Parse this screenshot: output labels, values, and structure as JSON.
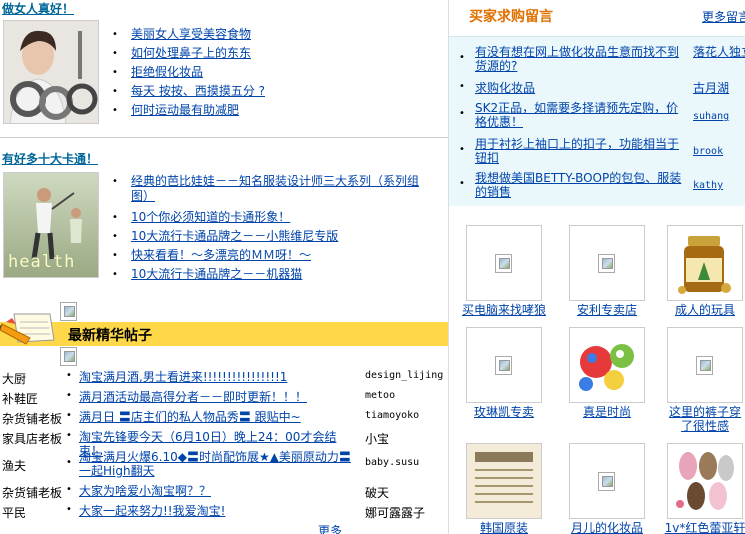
{
  "section1": {
    "title": "做女人真好！",
    "items": [
      "美丽女人享受美容食物",
      "如何处理鼻子上的东东",
      "拒绝假化妆品",
      "每天  按按、西摸摸五分  ?",
      "何时运动最有助减肥"
    ]
  },
  "section2": {
    "title": "有好多十大卡通！",
    "items": [
      "经典的芭比娃娃－－知名服装设计师三大系列（系列组图）",
      "10个你必须知道的卡通形象！",
      "10大流行卡通品牌之－－小熊维尼专版",
      "快来看看！～多漂亮的ＭＭ呀！～",
      "10大流行卡通品牌之－－机器猫"
    ],
    "thumb_caption": "health"
  },
  "featured": {
    "title": "最新精华帖子",
    "posts": [
      {
        "category": "大厨",
        "title": "淘宝满月酒,男士看进来!!!!!!!!!!!!!!!!1",
        "author": "design_lijing"
      },
      {
        "category": "补鞋匠",
        "title": "满月酒活动最高得分者－－即时更新！！！",
        "author": "metoo"
      },
      {
        "category": "杂货铺老板",
        "title": "满月日 〓店主们的私人物品秀〓 跟贴中~",
        "author": "tiamoyoko"
      },
      {
        "category": "家具店老板",
        "title": "淘宝先锋要今天（6月10日）晚上24：00才会结束！",
        "author": "小宝"
      },
      {
        "category": "渔夫",
        "title": "淘宝满月火爆6.10◆〓时尚配饰展★▲美丽原动力〓一起High翻天",
        "author": "baby.susu"
      },
      {
        "category": "杂货铺老板",
        "title": "大家为啥爱小淘宝啊？？",
        "author": "破天"
      },
      {
        "category": "平民",
        "title": "大家一起来努力!!我爱淘宝!",
        "author": "娜可露露子"
      }
    ],
    "more": "更多"
  },
  "requests": {
    "title": "买家求购留言",
    "more": "更多留言",
    "items": [
      {
        "text": "有没有想在网上做化妆品生意而找不到货源的?",
        "user": "落花人独立"
      },
      {
        "text": "求购化妆品",
        "user": "古月湖"
      },
      {
        "text": "SK2正品，如需要多择请预先定购，价格优惠！",
        "user": "suhang"
      },
      {
        "text": "用于衬衫上袖口上的扣子，功能相当于钮扣",
        "user": "brook"
      },
      {
        "text": "我想做美国BETTY-BOOP的包包、服装的销售",
        "user": "kathy"
      }
    ]
  },
  "shops": [
    {
      "label": "买电脑来找哮狼",
      "icon": "broken-image-icon"
    },
    {
      "label": "安利专卖店",
      "icon": "broken-image-icon"
    },
    {
      "label": "成人的玩具",
      "icon": "supplement-bottle-icon"
    },
    {
      "label": "玫琳凯专卖",
      "icon": "broken-image-icon"
    },
    {
      "label": "真是时尚",
      "icon": "balls-toy-icon"
    },
    {
      "label": "这里的裤子穿了很性感",
      "icon": "broken-image-icon"
    },
    {
      "label": "韩国原装",
      "icon": "newspaper-icon"
    },
    {
      "label": "月儿的化妆品",
      "icon": "broken-image-icon"
    },
    {
      "label": "1v*红色蕾亚轩",
      "icon": "slippers-icon"
    }
  ]
}
